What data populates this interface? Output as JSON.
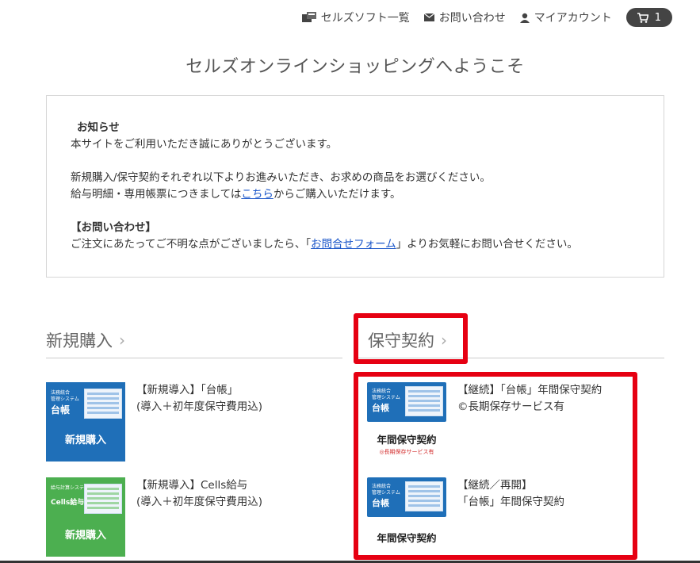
{
  "nav": {
    "soft_list": "セルズソフト一覧",
    "contact": "お問い合わせ",
    "account": "マイアカウント",
    "cart_count": "1"
  },
  "page_title": "セルズオンラインショッピングへようこそ",
  "notice": {
    "heading": "お知らせ",
    "line1": "本サイトをご利用いただき誠にありがとうございます。",
    "line2": "新規購入/保守契約それぞれ以下よりお進みいただき、お求めの商品をお選びください。",
    "line3_pre": "給与明細・専用帳票につきましては",
    "line3_link": "こちら",
    "line3_post": "からご購入いただけます。",
    "contact_heading": "【お問い合わせ】",
    "line4_pre": "ご注文にあたってご不明な点がございましたら、「",
    "line4_link": "お問合せフォーム",
    "line4_post": "」よりお気軽にお問い合せください。"
  },
  "new_section": {
    "title": "新規購入",
    "products": [
      {
        "thumb_small": "法務統合\n管理システム",
        "thumb_big": "台帳",
        "thumb_buy": "新規購入",
        "line1": "【新規導入】「台帳」",
        "line2": "(導入＋初年度保守費用込)"
      },
      {
        "thumb_small": "給与計算システム",
        "thumb_big": "Cells給与",
        "thumb_buy": "新規購入",
        "line1": "【新規導入】Cells給与",
        "line2": "(導入＋初年度保守費用込)"
      }
    ]
  },
  "maint_section": {
    "title": "保守契約",
    "products": [
      {
        "thumb_small": "法務統合\n管理システム",
        "thumb_big": "台帳",
        "label": "年間保守契約",
        "sub": "◎長期保存サービス有",
        "line1": "【継続】「台帳」年間保守契約",
        "line2": "©長期保存サービス有"
      },
      {
        "thumb_small": "法務統合\n管理システム",
        "thumb_big": "台帳",
        "label": "年間保守契約",
        "line1": "【継続／再開】",
        "line2": "「台帳」年間保守契約"
      }
    ]
  },
  "colors": {
    "highlight": "#e60012",
    "link": "#1a56c9",
    "thumb_blue": "#1f6fb8",
    "thumb_green": "#4caf50"
  }
}
